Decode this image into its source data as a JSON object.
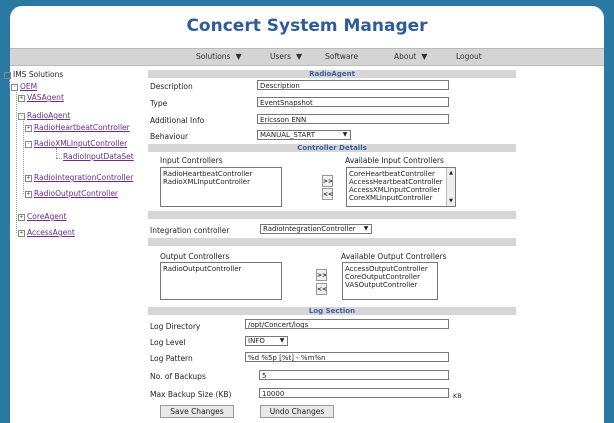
{
  "app": {
    "title": "Concert System Manager"
  },
  "nav": {
    "items": [
      {
        "label": "Solutions",
        "dropdown": true
      },
      {
        "label": "Users",
        "dropdown": true
      },
      {
        "label": "Software",
        "dropdown": false
      },
      {
        "label": "About",
        "dropdown": true
      },
      {
        "label": "Logout",
        "dropdown": false
      }
    ],
    "dropdown_glyph": "▼"
  },
  "tree": {
    "root": "IMS Solutions",
    "oem": "OEM",
    "vas": "VASAgent",
    "radio": "RadioAgent",
    "heartbeat": "RadioHeartbeatController",
    "xmlinput": "RadioXMLInputController",
    "inputdataset": "RadioInputDataSet",
    "integration": "RadioIntegrationController",
    "output": "RadioOutputController",
    "core": "CoreAgent",
    "access": "AccessAgent",
    "collapse_glyph": "-",
    "expand_glyph": "+"
  },
  "agent": {
    "header": "RadioAgent",
    "description_label": "Description",
    "description_value": "Description",
    "type_label": "Type",
    "type_value": "EventSnapshot",
    "additional_label": "Additional Info",
    "additional_value": "Ericsson ENN",
    "behaviour_label": "Behaviour",
    "behaviour_value": "MANUAL_START"
  },
  "controller": {
    "header": "Controller Details",
    "input_label": "Input Controllers",
    "input_items": [
      "RadioHeartbeatController",
      "RadioXMLInputController"
    ],
    "avail_input_label": "Available Input Controllers",
    "avail_input_items": [
      "CoreHeartbeatController",
      "AccessHeartbeatController",
      "AccessXMLInputController",
      "CoreXMLInputController"
    ],
    "integration_label": "Integration controller",
    "integration_value": "RadioIntegrationController",
    "output_label": "Output Controllers",
    "output_items": [
      "RadioOutputController"
    ],
    "avail_output_label": "Available Output Controllers",
    "avail_output_items": [
      "AccessOutputController",
      "CoreOutputController",
      "VASOutputController"
    ],
    "add_glyph": ">>",
    "remove_glyph": "<<"
  },
  "log": {
    "header": "Log Section",
    "dir_label": "Log Directory",
    "dir_value": "/opt/Concert/logs",
    "level_label": "Log Level",
    "level_value": "INFO",
    "pattern_label": "Log Pattern",
    "pattern_value": "%d %5p [%t] - %m%n",
    "backups_label": "No. of Backups",
    "backups_value": "5",
    "maxsize_label": "Max Backup Size (KB)",
    "maxsize_value": "10000",
    "maxsize_unit": "KB"
  },
  "actions": {
    "save": "Save Changes",
    "undo": "Undo Changes"
  },
  "icons": {
    "select_arrow": "▼",
    "scroll_up": "▲",
    "scroll_down": "▼"
  }
}
